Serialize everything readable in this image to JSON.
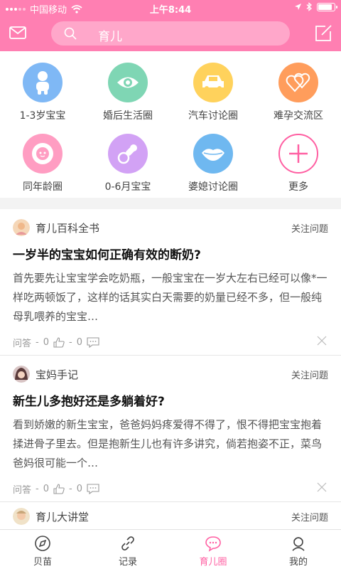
{
  "status_bar": {
    "carrier": "中国移动",
    "time": "上午8:44",
    "battery_level": 0.85
  },
  "header": {
    "search_text": "育儿"
  },
  "categories": [
    {
      "label": "1-3岁宝宝",
      "color": "#7fb8f5",
      "icon": "toddler-icon"
    },
    {
      "label": "婚后生活圈",
      "color": "#7fd6b4",
      "icon": "eye-icon"
    },
    {
      "label": "汽车讨论圈",
      "color": "#ffd25c",
      "icon": "car-icon"
    },
    {
      "label": "难孕交流区",
      "color": "#ff9d5c",
      "icon": "hearts-icon"
    },
    {
      "label": "同年龄圈",
      "color": "#ff9dc2",
      "icon": "baby-face-icon"
    },
    {
      "label": "0-6月宝宝",
      "color": "#d2a2f5",
      "icon": "pacifier-icon"
    },
    {
      "label": "婆媳讨论圈",
      "color": "#6fb8f0",
      "icon": "lips-icon"
    },
    {
      "label": "更多",
      "color": "#ff5fa2",
      "icon": "plus-icon"
    }
  ],
  "feed": [
    {
      "source": "育儿百科全书",
      "follow": "关注问题",
      "title": "一岁半的宝宝如何正确有效的断奶?",
      "excerpt": "首先要先让宝宝学会吃奶瓶，一般宝宝在一岁大左右已经可以像*一样吃两顿饭了，这样的话其实白天需要的奶量已经不多，但一般纯母乳喂养的宝宝…",
      "type": "问答",
      "likes": "0",
      "comments": "0"
    },
    {
      "source": "宝妈手记",
      "follow": "关注问题",
      "title": "新生儿多抱好还是多躺着好?",
      "excerpt": "看到娇嫩的新生宝宝，爸爸妈妈疼爱得不得了，恨不得把宝宝抱着揉进骨子里去。但是抱新生儿也有许多讲究，倘若抱姿不正，菜鸟爸妈很可能一个…",
      "type": "问答",
      "likes": "0",
      "comments": "0"
    },
    {
      "source": "育儿大讲堂",
      "follow": "关注问题"
    }
  ],
  "tabs": [
    {
      "label": "贝苗",
      "icon": "compass-icon"
    },
    {
      "label": "记录",
      "icon": "link-icon"
    },
    {
      "label": "育儿圈",
      "icon": "chat-bubble-icon",
      "active": true
    },
    {
      "label": "我的",
      "icon": "user-icon"
    }
  ],
  "colors": {
    "brand_pink": "#ff7fb2",
    "active_tab": "#ff5fa2"
  }
}
